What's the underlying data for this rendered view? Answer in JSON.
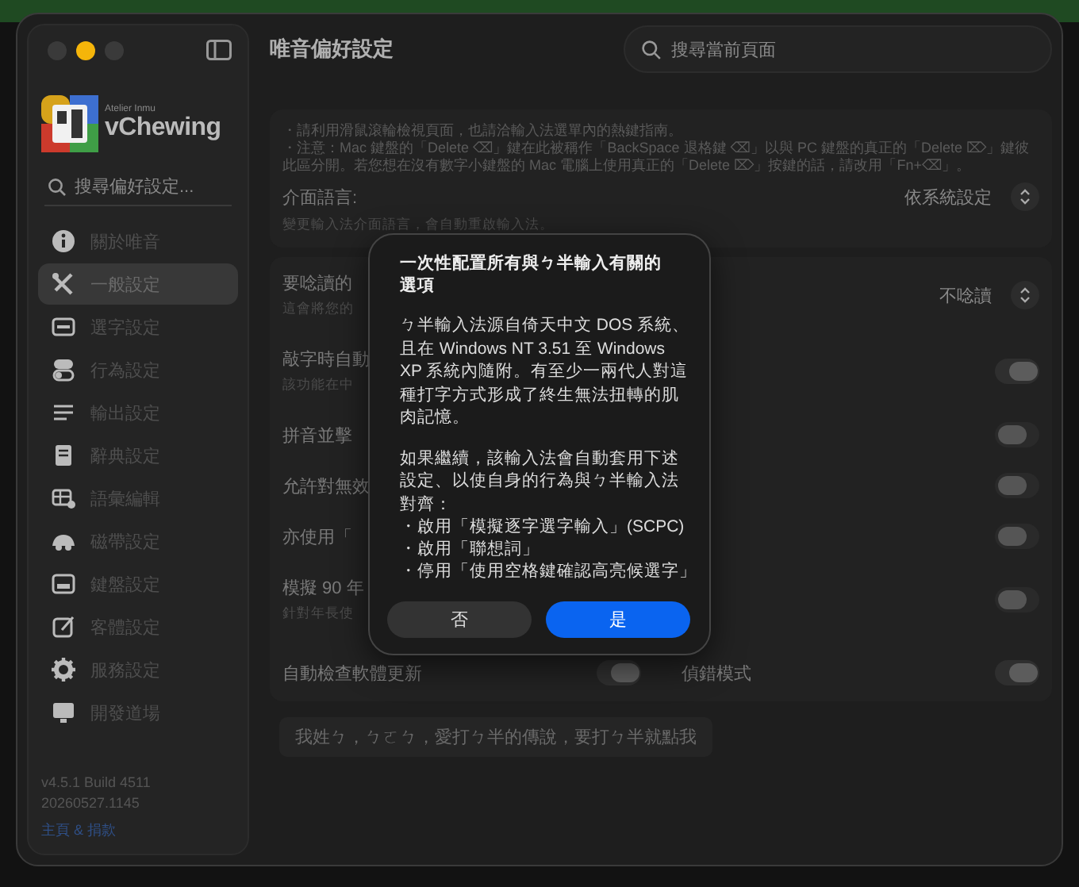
{
  "window": {
    "title": "唯音偏好設定",
    "traffic_lights": [
      {
        "color": "#3a3a3a"
      },
      {
        "color": "#f5b50a"
      },
      {
        "color": "#3a3a3a"
      }
    ]
  },
  "sidebar": {
    "brand_tagline": "Atelier Inmu",
    "brand_name": "vChewing",
    "search": {
      "placeholder": "搜尋偏好設定..."
    },
    "items": [
      {
        "label": "關於唯音",
        "selected": false
      },
      {
        "label": "一般設定",
        "selected": true
      },
      {
        "label": "選字設定",
        "selected": false
      },
      {
        "label": "行為設定",
        "selected": false
      },
      {
        "label": "輸出設定",
        "selected": false
      },
      {
        "label": "辭典設定",
        "selected": false
      },
      {
        "label": "語彙編輯",
        "selected": false
      },
      {
        "label": "磁帶設定",
        "selected": false
      },
      {
        "label": "鍵盤設定",
        "selected": false
      },
      {
        "label": "客體設定",
        "selected": false
      },
      {
        "label": "服務設定",
        "selected": false
      },
      {
        "label": "開發道場",
        "selected": false
      }
    ],
    "version": "v4.5.1 Build 4511",
    "build_date": "20260527.1145",
    "link": "主頁 & 捐款"
  },
  "search": {
    "placeholder": "搜尋當前頁面"
  },
  "notes": [
    "・請利用滑鼠滾輪檢視頁面，也請洽輸入法選單內的熱鍵指南。",
    "・注意：Mac 鍵盤的「Delete ⌫」鍵在此被稱作「BackSpace 退格鍵 ⌫」以與 PC 鍵盤的真正的「Delete ⌦」鍵彼此區分開。若您想在沒有數字小鍵盤的 Mac 電腦上使用真正的「Delete ⌦」按鍵的話，請改用「Fn+⌫」。"
  ],
  "language": {
    "label": "介面語言:",
    "value": "依系統設定",
    "description": "變更輸入法介面語言，會自動重啟輸入法。"
  },
  "settings": [
    {
      "kind": "popup",
      "label": "要唸讀的",
      "description": "這會將您的",
      "value": "不唸讀"
    },
    {
      "kind": "toggle",
      "label": "敲字時自動",
      "description": "該功能在中",
      "on": true
    },
    {
      "kind": "toggle",
      "label": "拼音並擊",
      "on": false
    },
    {
      "kind": "toggle",
      "label": "允許對無效",
      "on": false
    },
    {
      "kind": "toggle",
      "label": "亦使用「",
      "on": false
    },
    {
      "kind": "toggle",
      "label": "模擬 90 年",
      "description": "針對年長使",
      "on": false
    }
  ],
  "pair_toggles": [
    {
      "label": "自動檢查軟體更新",
      "on": true
    },
    {
      "label": "偵錯模式",
      "on": true
    }
  ],
  "easter_button": "我姓ㄅ，ㄅㄛㄅ，愛打ㄅ半的傳說，要打ㄅ半就點我",
  "dialog": {
    "title": "一次性配置所有與ㄅ半輸入有關的選項",
    "paragraphs": [
      "ㄅ半輸入法源自倚天中文 DOS 系統、且在 Windows NT 3.51 至 Windows XP 系統內隨附。有至少一兩代人對這種打字方式形成了終生無法扭轉的肌肉記憶。",
      "如果繼續，該輸入法會自動套用下述設定、以使自身的行為與ㄅ半輸入法對齊："
    ],
    "bullets": [
      "・啟用「模擬逐字選字輸入」(SCPC)",
      "・啟用「聯想詞」",
      "・停用「使用空格鍵確認高亮候選字」"
    ],
    "buttons": [
      {
        "label": "否",
        "kind": "secondary"
      },
      {
        "label": "是",
        "kind": "primary"
      }
    ]
  }
}
